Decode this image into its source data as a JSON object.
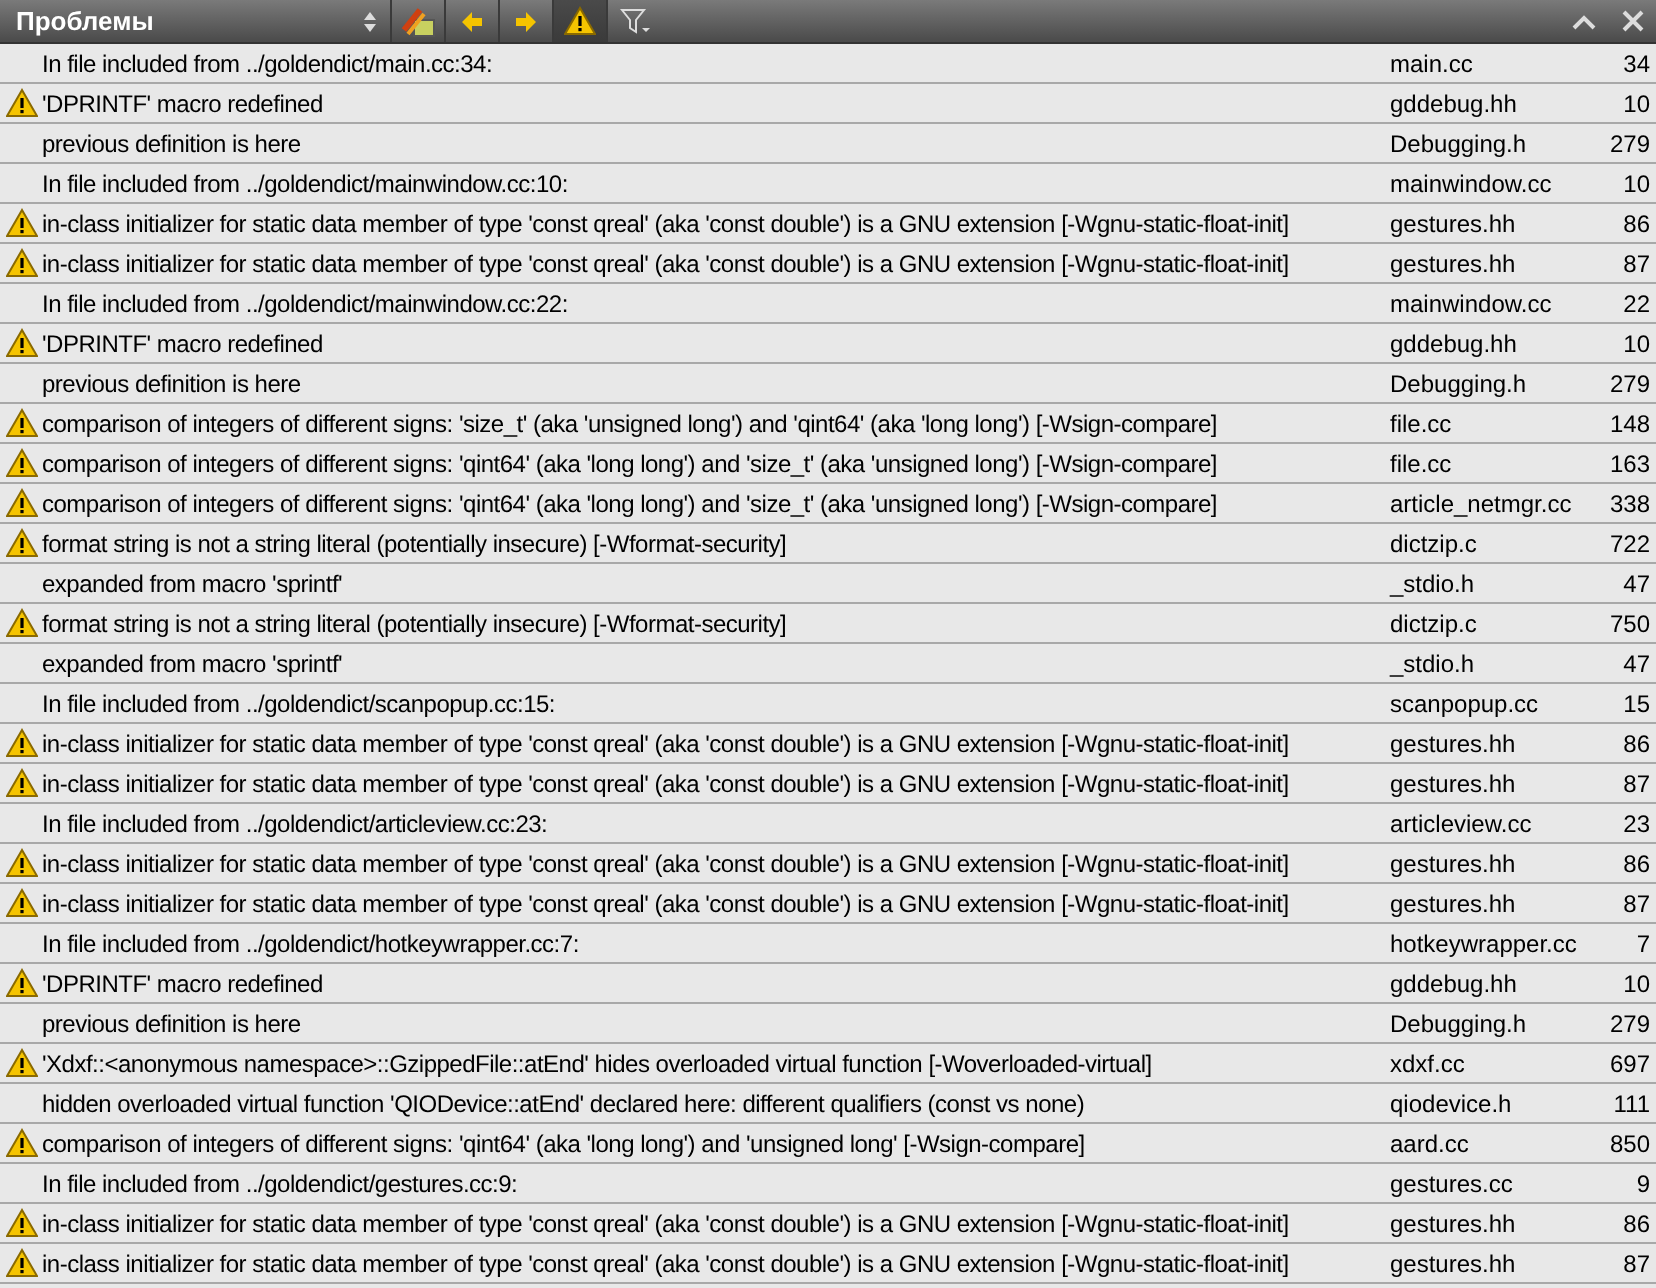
{
  "toolbar": {
    "title": "Проблемы",
    "show_warnings_on": true
  },
  "issues": [
    {
      "kind": "note",
      "text": "In file included from ../goldendict/main.cc:34:",
      "file": "main.cc",
      "line": "34"
    },
    {
      "kind": "warning",
      "text": "'DPRINTF' macro redefined",
      "file": "gddebug.hh",
      "line": "10"
    },
    {
      "kind": "note",
      "text": "previous definition is here",
      "file": "Debugging.h",
      "line": "279"
    },
    {
      "kind": "note",
      "text": "In file included from ../goldendict/mainwindow.cc:10:",
      "file": "mainwindow.cc",
      "line": "10"
    },
    {
      "kind": "warning",
      "text": "in-class initializer for static data member of type 'const qreal' (aka 'const double') is a GNU extension [-Wgnu-static-float-init]",
      "file": "gestures.hh",
      "line": "86"
    },
    {
      "kind": "warning",
      "text": "in-class initializer for static data member of type 'const qreal' (aka 'const double') is a GNU extension [-Wgnu-static-float-init]",
      "file": "gestures.hh",
      "line": "87"
    },
    {
      "kind": "note",
      "text": "In file included from ../goldendict/mainwindow.cc:22:",
      "file": "mainwindow.cc",
      "line": "22"
    },
    {
      "kind": "warning",
      "text": "'DPRINTF' macro redefined",
      "file": "gddebug.hh",
      "line": "10"
    },
    {
      "kind": "note",
      "text": "previous definition is here",
      "file": "Debugging.h",
      "line": "279"
    },
    {
      "kind": "warning",
      "text": "comparison of integers of different signs: 'size_t' (aka 'unsigned long') and 'qint64' (aka 'long long') [-Wsign-compare]",
      "file": "file.cc",
      "line": "148"
    },
    {
      "kind": "warning",
      "text": "comparison of integers of different signs: 'qint64' (aka 'long long') and 'size_t' (aka 'unsigned long') [-Wsign-compare]",
      "file": "file.cc",
      "line": "163"
    },
    {
      "kind": "warning",
      "text": "comparison of integers of different signs: 'qint64' (aka 'long long') and 'size_t' (aka 'unsigned long') [-Wsign-compare]",
      "file": "article_netmgr.cc",
      "line": "338"
    },
    {
      "kind": "warning",
      "text": "format string is not a string literal (potentially insecure) [-Wformat-security]",
      "file": "dictzip.c",
      "line": "722"
    },
    {
      "kind": "note",
      "text": "expanded from macro 'sprintf'",
      "file": "_stdio.h",
      "line": "47"
    },
    {
      "kind": "warning",
      "text": "format string is not a string literal (potentially insecure) [-Wformat-security]",
      "file": "dictzip.c",
      "line": "750"
    },
    {
      "kind": "note",
      "text": "expanded from macro 'sprintf'",
      "file": "_stdio.h",
      "line": "47"
    },
    {
      "kind": "note",
      "text": "In file included from ../goldendict/scanpopup.cc:15:",
      "file": "scanpopup.cc",
      "line": "15"
    },
    {
      "kind": "warning",
      "text": "in-class initializer for static data member of type 'const qreal' (aka 'const double') is a GNU extension [-Wgnu-static-float-init]",
      "file": "gestures.hh",
      "line": "86"
    },
    {
      "kind": "warning",
      "text": "in-class initializer for static data member of type 'const qreal' (aka 'const double') is a GNU extension [-Wgnu-static-float-init]",
      "file": "gestures.hh",
      "line": "87"
    },
    {
      "kind": "note",
      "text": "In file included from ../goldendict/articleview.cc:23:",
      "file": "articleview.cc",
      "line": "23"
    },
    {
      "kind": "warning",
      "text": "in-class initializer for static data member of type 'const qreal' (aka 'const double') is a GNU extension [-Wgnu-static-float-init]",
      "file": "gestures.hh",
      "line": "86"
    },
    {
      "kind": "warning",
      "text": "in-class initializer for static data member of type 'const qreal' (aka 'const double') is a GNU extension [-Wgnu-static-float-init]",
      "file": "gestures.hh",
      "line": "87"
    },
    {
      "kind": "note",
      "text": "In file included from ../goldendict/hotkeywrapper.cc:7:",
      "file": "hotkeywrapper.cc",
      "line": "7"
    },
    {
      "kind": "warning",
      "text": "'DPRINTF' macro redefined",
      "file": "gddebug.hh",
      "line": "10"
    },
    {
      "kind": "note",
      "text": "previous definition is here",
      "file": "Debugging.h",
      "line": "279"
    },
    {
      "kind": "warning",
      "text": "'Xdxf::<anonymous namespace>::GzippedFile::atEnd' hides overloaded virtual function [-Woverloaded-virtual]",
      "file": "xdxf.cc",
      "line": "697"
    },
    {
      "kind": "note",
      "text": "hidden overloaded virtual function 'QIODevice::atEnd' declared here: different qualifiers (const vs none)",
      "file": "qiodevice.h",
      "line": "111"
    },
    {
      "kind": "warning",
      "text": "comparison of integers of different signs: 'qint64' (aka 'long long') and 'unsigned long' [-Wsign-compare]",
      "file": "aard.cc",
      "line": "850"
    },
    {
      "kind": "note",
      "text": "In file included from ../goldendict/gestures.cc:9:",
      "file": "gestures.cc",
      "line": "9"
    },
    {
      "kind": "warning",
      "text": "in-class initializer for static data member of type 'const qreal' (aka 'const double') is a GNU extension [-Wgnu-static-float-init]",
      "file": "gestures.hh",
      "line": "86"
    },
    {
      "kind": "warning",
      "text": "in-class initializer for static data member of type 'const qreal' (aka 'const double') is a GNU extension [-Wgnu-static-float-init]",
      "file": "gestures.hh",
      "line": "87"
    }
  ]
}
